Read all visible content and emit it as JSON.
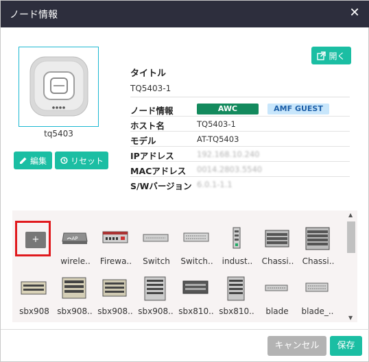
{
  "dialog": {
    "title": "ノード情報",
    "close_icon": "close-icon",
    "open_label": "開く",
    "open_icon": "external-link-icon"
  },
  "node": {
    "thumbnail_icon": "access-point-device-icon",
    "label": "tq5403",
    "edit_label": "編集",
    "edit_icon": "pencil-icon",
    "reset_label": "リセット",
    "reset_icon": "history-icon"
  },
  "info": {
    "section_title": "タイトル",
    "name_value": "TQ5403-1",
    "rows": [
      {
        "key": "ノード情報",
        "badges": [
          "AWC",
          "AMF GUEST"
        ]
      },
      {
        "key": "ホスト名",
        "value": "TQ5403-1"
      },
      {
        "key": "モデル",
        "value": "AT-TQ5403"
      },
      {
        "key": "IPアドレス",
        "value": "192.168.10.240"
      },
      {
        "key": "MACアドレス",
        "value": "0014.2803.5540"
      },
      {
        "key": "S/Wバージョン",
        "value": "6.0.1-1.1"
      }
    ],
    "badge_colors": {
      "awc": "#138a5d",
      "amf": "#c8e6fb"
    }
  },
  "gallery": {
    "add_label": "+",
    "items": [
      {
        "label": "wirele..",
        "icon": "wireless-ap-icon"
      },
      {
        "label": "Firewa..",
        "icon": "firewall-icon"
      },
      {
        "label": "Switch",
        "icon": "switch-icon"
      },
      {
        "label": "Switch..",
        "icon": "switch-icon"
      },
      {
        "label": "indust..",
        "icon": "industrial-switch-icon"
      },
      {
        "label": "Chassi..",
        "icon": "chassis-icon"
      },
      {
        "label": "Chassi..",
        "icon": "chassis-icon"
      },
      {
        "label": "sbx908",
        "icon": "sbx908-icon"
      },
      {
        "label": "sbx908..",
        "icon": "sbx908-icon"
      },
      {
        "label": "sbx908..",
        "icon": "sbx908-icon"
      },
      {
        "label": "sbx908..",
        "icon": "sbx908-icon"
      },
      {
        "label": "sbx810..",
        "icon": "sbx810-icon"
      },
      {
        "label": "sbx810..",
        "icon": "sbx810-icon"
      },
      {
        "label": "blade",
        "icon": "blade-icon"
      },
      {
        "label": "blade_..",
        "icon": "blade-icon"
      }
    ]
  },
  "footer": {
    "cancel_label": "キャンセル",
    "save_label": "保存"
  },
  "colors": {
    "titlebar": "#2d2e3d",
    "accent": "#1bbea3",
    "highlight": "#e0191d"
  }
}
